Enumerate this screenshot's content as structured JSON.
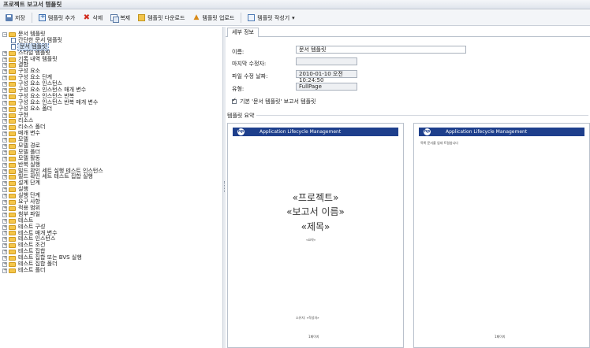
{
  "window": {
    "title": "프로젝트 보고서 템플릿"
  },
  "toolbar": {
    "save": "저장",
    "add_template": "템플릿 추가",
    "delete": "삭제",
    "copy": "복제",
    "download_template": "템플릿 다운로드",
    "upload_template": "템플릿 업로드",
    "template_creator": "템플릿 작성기",
    "template_creator_arrow": "▾"
  },
  "tree": [
    {
      "label": "문서 템플릿",
      "level": 0,
      "exp": "−",
      "icon": "folder"
    },
    {
      "label": "간단한 문서 템플릿",
      "level": 1,
      "exp": "",
      "icon": "doc"
    },
    {
      "label": "문서 템플릿",
      "level": 1,
      "exp": "",
      "icon": "doc",
      "selected": true
    },
    {
      "label": "스타일 템플릿",
      "level": 0,
      "exp": "+",
      "icon": "folder"
    },
    {
      "label": "기록 내역 템플릿",
      "level": 0,
      "exp": "+",
      "icon": "folder"
    },
    {
      "label": "결함",
      "level": 0,
      "exp": "+",
      "icon": "folder"
    },
    {
      "label": "구성 요소",
      "level": 0,
      "exp": "+",
      "icon": "folder"
    },
    {
      "label": "구성 요소 단계",
      "level": 0,
      "exp": "+",
      "icon": "folder"
    },
    {
      "label": "구성 요소 인스턴스",
      "level": 0,
      "exp": "+",
      "icon": "folder"
    },
    {
      "label": "구성 요소 인스턴스 매개 변수",
      "level": 0,
      "exp": "+",
      "icon": "folder"
    },
    {
      "label": "구성 요소 인스턴스 반복",
      "level": 0,
      "exp": "+",
      "icon": "folder"
    },
    {
      "label": "구성 요소 인스턴스 반복 매개 변수",
      "level": 0,
      "exp": "+",
      "icon": "folder"
    },
    {
      "label": "구성 요소 폴더",
      "level": 0,
      "exp": "+",
      "icon": "folder"
    },
    {
      "label": "구현",
      "level": 0,
      "exp": "+",
      "icon": "folder"
    },
    {
      "label": "리소스",
      "level": 0,
      "exp": "+",
      "icon": "folder"
    },
    {
      "label": "리소스 폴더",
      "level": 0,
      "exp": "+",
      "icon": "folder"
    },
    {
      "label": "매개 변수",
      "level": 0,
      "exp": "+",
      "icon": "folder"
    },
    {
      "label": "모델",
      "level": 0,
      "exp": "+",
      "icon": "folder"
    },
    {
      "label": "모델 경로",
      "level": 0,
      "exp": "+",
      "icon": "folder"
    },
    {
      "label": "모델 폴더",
      "level": 0,
      "exp": "+",
      "icon": "folder"
    },
    {
      "label": "모델 활동",
      "level": 0,
      "exp": "+",
      "icon": "folder"
    },
    {
      "label": "반복 실행",
      "level": 0,
      "exp": "+",
      "icon": "folder"
    },
    {
      "label": "빌드 확인 세트 실행 테스트 인스턴스",
      "level": 0,
      "exp": "+",
      "icon": "folder"
    },
    {
      "label": "빌드 확인 세트 테스트 집합 실행",
      "level": 0,
      "exp": "+",
      "icon": "folder"
    },
    {
      "label": "설계 단계",
      "level": 0,
      "exp": "+",
      "icon": "folder"
    },
    {
      "label": "실행",
      "level": 0,
      "exp": "+",
      "icon": "folder"
    },
    {
      "label": "실행 단계",
      "level": 0,
      "exp": "+",
      "icon": "folder"
    },
    {
      "label": "요구 사항",
      "level": 0,
      "exp": "+",
      "icon": "folder"
    },
    {
      "label": "적용 범위",
      "level": 0,
      "exp": "+",
      "icon": "folder"
    },
    {
      "label": "첨부 파일",
      "level": 0,
      "exp": "+",
      "icon": "folder"
    },
    {
      "label": "테스트",
      "level": 0,
      "exp": "+",
      "icon": "folder"
    },
    {
      "label": "테스트 구성",
      "level": 0,
      "exp": "+",
      "icon": "folder"
    },
    {
      "label": "테스트 매개 변수",
      "level": 0,
      "exp": "+",
      "icon": "folder"
    },
    {
      "label": "테스트 인스턴스",
      "level": 0,
      "exp": "+",
      "icon": "folder"
    },
    {
      "label": "테스트 조건",
      "level": 0,
      "exp": "+",
      "icon": "folder"
    },
    {
      "label": "테스트 집합",
      "level": 0,
      "exp": "+",
      "icon": "folder"
    },
    {
      "label": "테스트 집합 또는 BVS 실행",
      "level": 0,
      "exp": "+",
      "icon": "folder"
    },
    {
      "label": "테스트 집합 폴더",
      "level": 0,
      "exp": "+",
      "icon": "folder"
    },
    {
      "label": "테스트 폴더",
      "level": 0,
      "exp": "+",
      "icon": "folder"
    }
  ],
  "details": {
    "tab": "세부 정보",
    "name_label": "이름:",
    "name_value": "문서 템플릿",
    "modifier_label": "마지막 수정자:",
    "modifier_value": "",
    "modified_label": "파일 수정 날짜:",
    "modified_value": "2010-01-10 오전 10:24:50",
    "type_label": "유형:",
    "type_value": "FullPage",
    "default_check": "기본 '문서 템플릿' 보고서 템플릿",
    "summary_title": "템플릿 요약"
  },
  "preview": {
    "header": "Application Lifecycle Management",
    "logo": "hp",
    "title_lines": [
      "«프로젝트»",
      "«보고서 이름»",
      "«제목»"
    ],
    "subtitle": "«요약»",
    "author": "소유자: «작성자»",
    "page_no": "1페이지",
    "toc": "목록 문서를 업데 트릴씀니다"
  }
}
